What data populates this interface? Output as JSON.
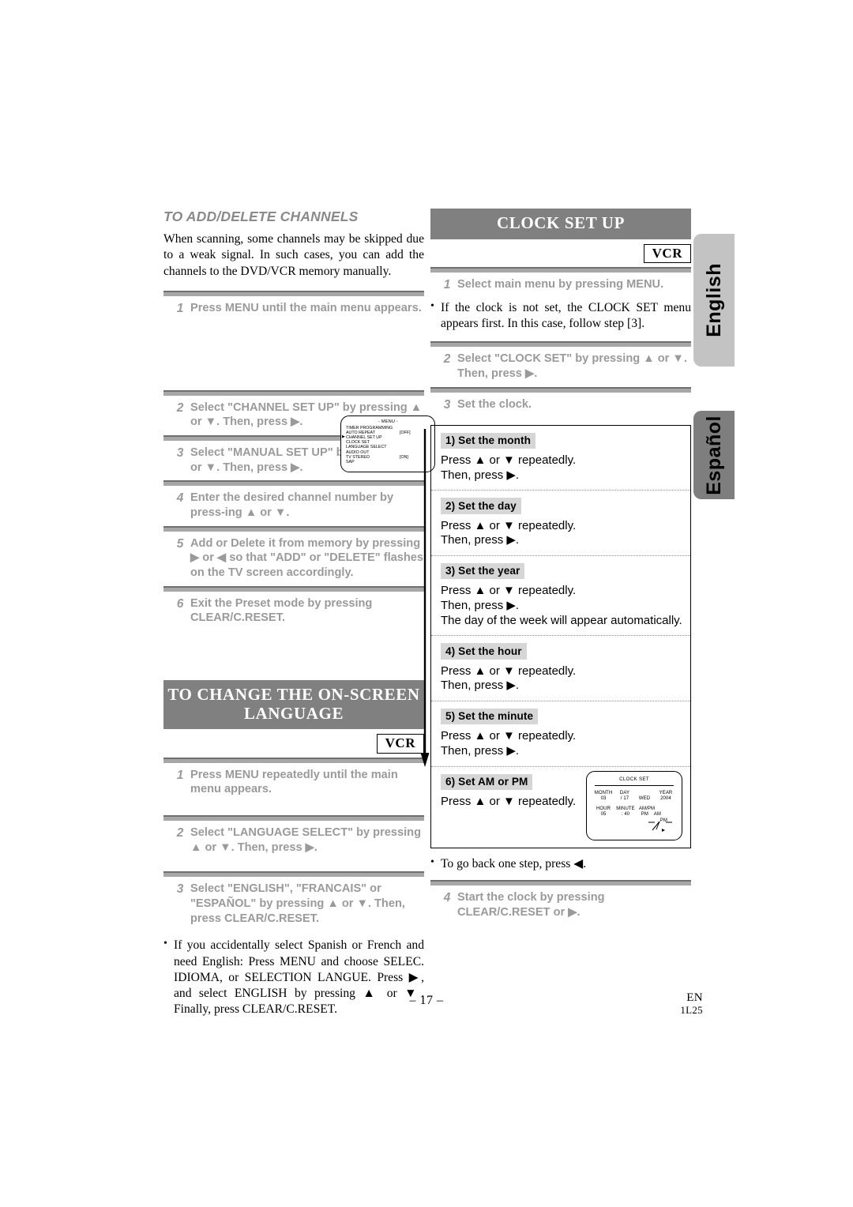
{
  "left_column": {
    "section1": {
      "heading": "TO ADD/DELETE CHANNELS",
      "intro": "When scanning, some channels may be skipped due to a weak signal. In such cases, you can add  the channels to the DVD/VCR memory manually.",
      "steps": [
        {
          "num": "1",
          "text": "Press MENU until the main menu appears."
        },
        {
          "num": "2",
          "text": "Select \"CHANNEL SET UP\" by pressing ▲ or ▼. Then, press ▶."
        },
        {
          "num": "3",
          "text": "Select \"MANUAL SET UP\" by pressing ▲ or ▼. Then, press ▶."
        },
        {
          "num": "4",
          "text": "Enter the desired channel number by press-ing ▲ or ▼."
        },
        {
          "num": "5",
          "text": "Add or Delete it from memory by pressing ▶ or ◀ so that \"ADD\" or \"DELETE\" flashes on the TV screen accordingly."
        },
        {
          "num": "6",
          "text": "Exit the Preset mode by pressing CLEAR/C.RESET."
        }
      ],
      "osd_menu": {
        "title": "- MENU -",
        "items": [
          {
            "label": "TIMER PROGRAMMING",
            "value": ""
          },
          {
            "label": "AUTO REPEAT",
            "value": "[OFF]"
          },
          {
            "label": "CHANNEL SET UP",
            "value": "",
            "cursor": true
          },
          {
            "label": "CLOCK SET",
            "value": ""
          },
          {
            "label": "LANGUAGE SELECT",
            "value": ""
          },
          {
            "label": "AUDIO OUT",
            "value": ""
          },
          {
            "label": "TV STEREO",
            "value": "[ON]"
          },
          {
            "label": "SAP",
            "value": ""
          }
        ]
      }
    },
    "section2": {
      "heading_line1": "TO CHANGE THE ON-SCREEN",
      "heading_line2": "LANGUAGE",
      "badge": "VCR",
      "steps": [
        {
          "num": "1",
          "text": "Press MENU repeatedly until the main menu appears."
        },
        {
          "num": "2",
          "text": "Select \"LANGUAGE SELECT\" by pressing ▲ or ▼. Then, press ▶."
        },
        {
          "num": "3",
          "text": "Select \"ENGLISH\", \"FRANCAIS\" or \"ESPAÑOL\" by pressing ▲ or ▼. Then, press CLEAR/C.RESET."
        }
      ],
      "note": "If you accidentally select Spanish or French and need English: Press MENU and choose SELEC. IDIOMA, or SELECTION LANGUE. Press ▶, and select ENGLISH by pressing ▲ or ▼. Finally, press CLEAR/C.RESET."
    }
  },
  "right_column": {
    "heading": "CLOCK SET UP",
    "badge": "VCR",
    "step1": {
      "num": "1",
      "text": "Select main menu by pressing MENU."
    },
    "note1": "If the clock is not set, the CLOCK SET menu appears first. In this case, follow step [3].",
    "step2": {
      "num": "2",
      "text": "Select \"CLOCK SET\" by pressing ▲ or ▼. Then, press ▶."
    },
    "step3": {
      "num": "3",
      "text": "Set the clock."
    },
    "clock_steps": [
      {
        "label": "1) Set the month",
        "lines": [
          "Press ▲ or ▼ repeatedly.",
          "Then, press ▶."
        ]
      },
      {
        "label": "2) Set the day",
        "lines": [
          "Press ▲ or ▼ repeatedly.",
          "Then, press ▶."
        ]
      },
      {
        "label": "3) Set the year",
        "lines": [
          "Press ▲ or ▼ repeatedly.",
          "Then, press ▶.",
          "The day of the week will appear automatically."
        ]
      },
      {
        "label": "4) Set the hour",
        "lines": [
          "Press ▲ or ▼ repeatedly.",
          "Then, press ▶."
        ]
      },
      {
        "label": "5) Set the minute",
        "lines": [
          "Press ▲ or ▼ repeatedly.",
          "Then, press ▶."
        ]
      },
      {
        "label": "6) Set AM or PM",
        "lines": [
          "Press  ▲ or ▼ repeatedly."
        ]
      }
    ],
    "osd_clock": {
      "title": "CLOCK SET",
      "header_row1": [
        "MONTH",
        "DAY",
        "",
        "YEAR"
      ],
      "value_row1": [
        "03",
        "/ 17",
        "WED",
        "2004"
      ],
      "header_row2": [
        "HOUR",
        "MINUTE",
        "AM/PM"
      ],
      "value_row2": [
        "05",
        ": 40",
        "PM",
        "AM",
        "PM"
      ]
    },
    "note2": "To go back one step, press ◀.",
    "step4": {
      "num": "4",
      "text": "Start the clock by pressing CLEAR/C.RESET or ▶."
    }
  },
  "side_tabs": [
    {
      "label": "English"
    },
    {
      "label": "Español"
    }
  ],
  "footer": {
    "page": "– 17 –",
    "lang_code": "EN",
    "doc_code": "1L25"
  }
}
